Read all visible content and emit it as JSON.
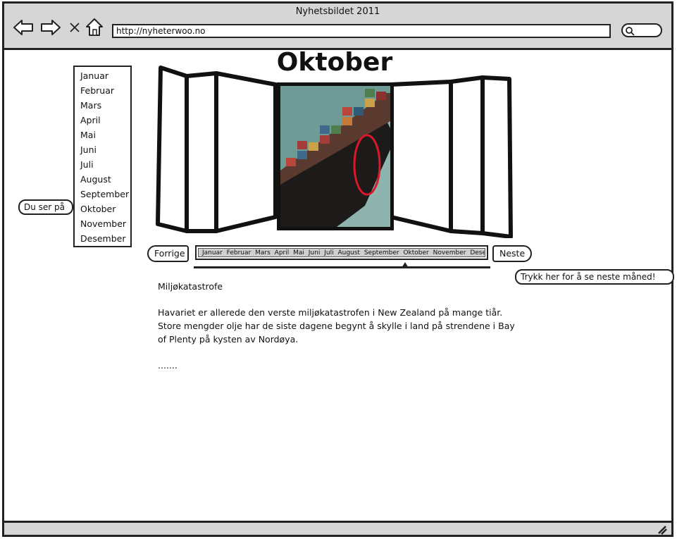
{
  "window": {
    "title": "Nyhetsbildet 2011",
    "url": "http://nyheterwoo.no"
  },
  "sidebar": {
    "months": [
      "Januar",
      "Februar",
      "Mars",
      "April",
      "Mai",
      "Juni",
      "Juli",
      "August",
      "September",
      "Oktober",
      "November",
      "Desember"
    ],
    "selected": "Oktober"
  },
  "callouts": {
    "current": "Du ser på",
    "next_hint": "Trykk her for å se neste måned!"
  },
  "carousel": {
    "current_month": "Oktober",
    "photo_icon": "container-ship-photo"
  },
  "controls": {
    "prev_label": "Forrige",
    "next_label": "Neste",
    "timeline_months": [
      "Januar",
      "Februar",
      "Mars",
      "April",
      "Mai",
      "Juni",
      "Juli",
      "August",
      "September",
      "Oktober",
      "November",
      "Desember"
    ]
  },
  "article": {
    "heading": "Miljøkatastrofe",
    "body": "Havariet er allerede den verste miljøkatastrofen i New Zealand på mange tiår. Store mengder olje har de siste dagene begynt å skylle i land på strendene i Bay of Plenty på kysten av Nordøya.",
    "ellipsis": "......."
  },
  "colors": {
    "chrome": "#d6d6d6",
    "outline": "#222222",
    "highlight_circle": "#d7192b"
  }
}
